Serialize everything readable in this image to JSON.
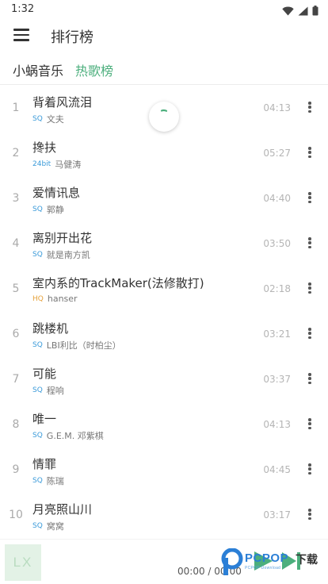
{
  "status_bar": {
    "time": "1:32"
  },
  "app_bar": {
    "title": "排行榜"
  },
  "tabs": [
    {
      "label": "小蜗音乐",
      "active": false
    },
    {
      "label": "热歌榜",
      "active": true
    }
  ],
  "colors": {
    "accent": "#4caf7d",
    "quality_sq": "#3a9ad9",
    "quality_24bit": "#3a9ad9",
    "quality_hq": "#e6a23c",
    "cover_bg": "#e3f2e6"
  },
  "songs": [
    {
      "rank": "1",
      "title": "背着风流泪",
      "quality": "SQ",
      "artist": "文夫",
      "duration": "04:13"
    },
    {
      "rank": "2",
      "title": "搀扶",
      "quality": "24bit",
      "artist": "马健涛",
      "duration": "05:27"
    },
    {
      "rank": "3",
      "title": "爱情讯息",
      "quality": "SQ",
      "artist": "郭静",
      "duration": "04:40"
    },
    {
      "rank": "4",
      "title": "离别开出花",
      "quality": "SQ",
      "artist": "就是南方凯",
      "duration": "03:50"
    },
    {
      "rank": "5",
      "title": "室内系的TrackMaker(法修散打)",
      "quality": "HQ",
      "artist": "hanser",
      "duration": "02:18"
    },
    {
      "rank": "6",
      "title": "跳楼机",
      "quality": "SQ",
      "artist": "LBI利比（时柏尘）",
      "duration": "03:21"
    },
    {
      "rank": "7",
      "title": "可能",
      "quality": "SQ",
      "artist": "程响",
      "duration": "03:37"
    },
    {
      "rank": "8",
      "title": "唯一",
      "quality": "SQ",
      "artist": "G.E.M. 邓紫棋",
      "duration": "04:13"
    },
    {
      "rank": "9",
      "title": "情罪",
      "quality": "SQ",
      "artist": "陈瑞",
      "duration": "04:45"
    },
    {
      "rank": "10",
      "title": "月亮照山川",
      "quality": "SQ",
      "artist": "窝窝",
      "duration": "03:17"
    }
  ],
  "player": {
    "cover_text": "LX",
    "time": "00:00 / 00:00",
    "icons": {
      "play": "play-icon",
      "next": "next-icon"
    }
  },
  "watermark": {
    "brand": "PCPOP",
    "sub": "PCPOP Download",
    "label": "下载"
  },
  "icons": {
    "menu": "menu-icon",
    "more": "more-vert-icon",
    "wifi": "wifi-icon",
    "signal": "signal-icon",
    "battery": "battery-icon",
    "loading": "loading-spinner-icon"
  }
}
